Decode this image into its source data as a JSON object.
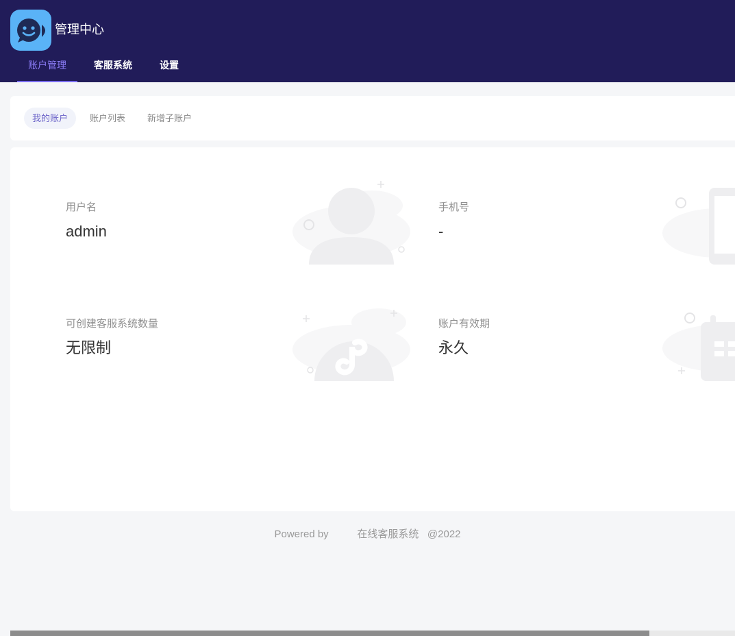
{
  "header": {
    "app_title": "管理中心",
    "logo_icon": "smiling-chat-bubble-icon",
    "nav": [
      {
        "label": "账户管理",
        "active": true
      },
      {
        "label": "客服系统",
        "active": false
      },
      {
        "label": "设置",
        "active": false
      }
    ]
  },
  "sub_nav": {
    "tabs": [
      {
        "label": "我的账户",
        "active": true
      },
      {
        "label": "账户列表",
        "active": false
      },
      {
        "label": "新增子账户",
        "active": false
      }
    ]
  },
  "account": {
    "username": {
      "label": "用户名",
      "value": "admin",
      "icon": "user-silhouette-icon"
    },
    "phone": {
      "label": "手机号",
      "value": "-",
      "icon": "mobile-phone-icon"
    },
    "quota": {
      "label": "可创建客服系统数量",
      "value": "无限制",
      "icon": "mini-program-icon"
    },
    "validity": {
      "label": "账户有效期",
      "value": "永久",
      "icon": "calendar-icon"
    }
  },
  "footer": {
    "powered_by": "Powered by",
    "product": "在线客服系统",
    "year": "@2022"
  },
  "colors": {
    "header_bg": "#211c59",
    "accent": "#7a6cf0",
    "logo_bg": "#5ab3f7",
    "page_bg": "#f5f6f8"
  }
}
